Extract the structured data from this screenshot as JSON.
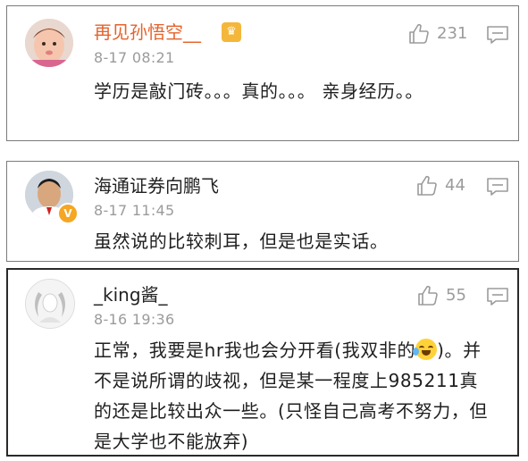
{
  "colors": {
    "vip_name": "#e5622b",
    "normal_name": "#222222",
    "secondary_text": "#9b9b9b",
    "verified_badge": "#f5a623"
  },
  "comments": [
    {
      "username": "再见孙悟空__",
      "time": "8-17 08:21",
      "likes": "231",
      "content": "学历是敲门砖。。。真的。。。 亲身经历。。",
      "avatar_icon": "baby-avatar",
      "badge_icon": "vip-crown-icon"
    },
    {
      "username": "海通证券向鹏飞",
      "time": "8-17 11:45",
      "likes": "44",
      "content": "虽然说的比较刺耳，但是也是实话。",
      "avatar_icon": "man-avatar",
      "badge_icon": "verified-v-icon",
      "badge_text": "V"
    },
    {
      "username": "_king酱_",
      "time": "8-16 19:36",
      "likes": "55",
      "content_before_emoji": "正常，我要是hr我也会分开看(我双非的",
      "content_after_emoji": ")。并不是说所谓的歧视，但是某一程度上985211真的还是比较出众一些。(只怪自己高考不努力，但是大学也不能放弃)",
      "emoji_icon": "laugh-cry-emoji-icon",
      "avatar_icon": "default-avatar"
    }
  ]
}
